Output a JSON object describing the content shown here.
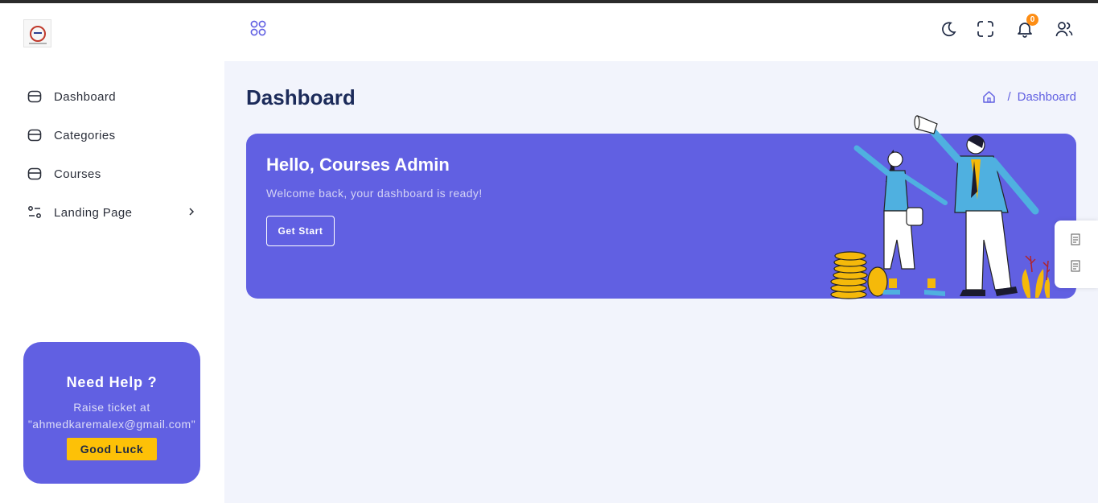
{
  "sidebar": {
    "logo_icon": "brand-logo",
    "items": [
      {
        "label": "Dashboard",
        "icon": "folder-icon"
      },
      {
        "label": "Categories",
        "icon": "folder-icon"
      },
      {
        "label": "Courses",
        "icon": "folder-icon"
      },
      {
        "label": "Landing Page",
        "icon": "sliders-icon",
        "has_submenu": true
      }
    ],
    "help": {
      "title": "Need Help ?",
      "line1": "Raise ticket at",
      "email": "\"ahmedkaremalex@gmail.com\"",
      "button": "Good Luck"
    }
  },
  "header": {
    "icons": [
      "apps-grid-icon",
      "moon-icon",
      "fullscreen-icon",
      "bell-icon",
      "users-icon"
    ],
    "notification_count": "0"
  },
  "page": {
    "title": "Dashboard",
    "breadcrumb": {
      "home_icon": "home-icon",
      "separator": "/",
      "current": "Dashboard"
    }
  },
  "banner": {
    "title": "Hello, Courses Admin",
    "subtitle": "Welcome back, your dashboard is ready!",
    "button": "Get Start"
  },
  "colors": {
    "accent": "#6160e2",
    "badge": "#fd8d14",
    "help_button": "#fdc107",
    "page_bg": "#f2f4fc",
    "title": "#1c2b5a"
  }
}
